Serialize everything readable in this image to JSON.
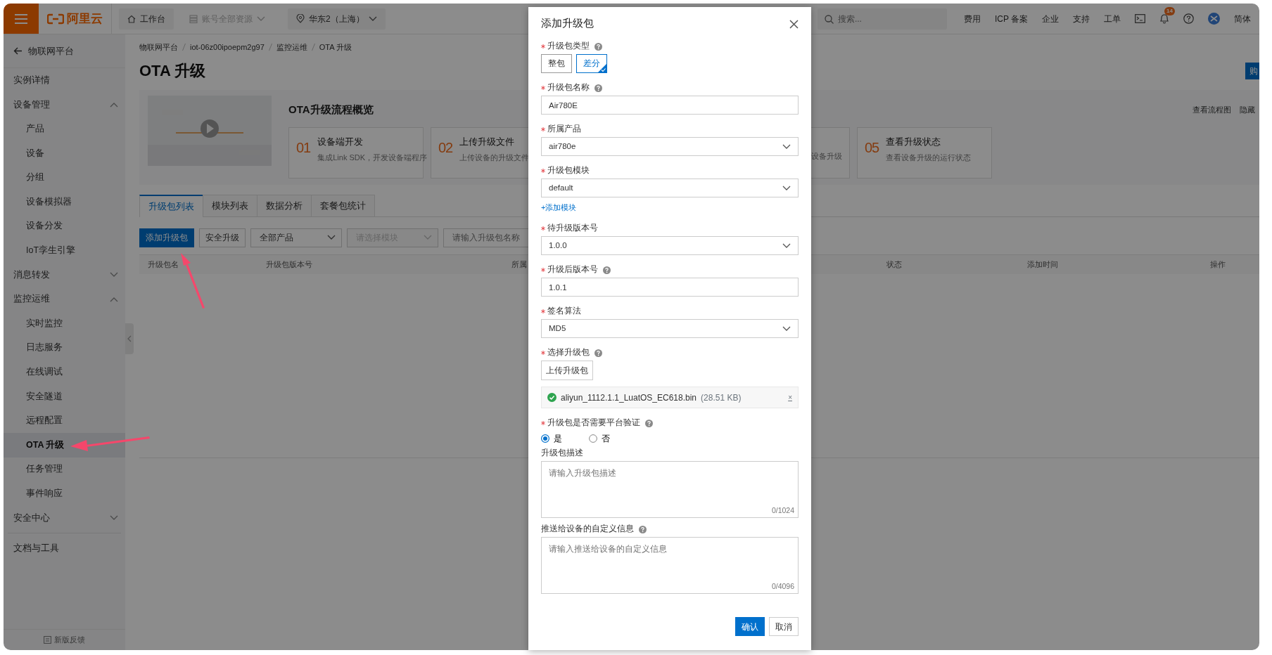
{
  "topbar": {
    "logo": "阿里云",
    "workbench": "工作台",
    "resource_group": {
      "label": "账号全部资源",
      "disabled": true
    },
    "region": "华东2（上海）",
    "search": {
      "placeholder": "搜索..."
    },
    "links": [
      "费用",
      "ICP 备案",
      "企业",
      "支持",
      "工单"
    ],
    "notification_count": "14",
    "language": "简体"
  },
  "sidebar": {
    "back_label": "物联网平台",
    "items": [
      {
        "label": "实例详情",
        "selected": false
      },
      {
        "label": "设备管理",
        "expanded": true,
        "selected": false,
        "children": [
          {
            "label": "产品",
            "selected": false
          },
          {
            "label": "设备",
            "selected": false
          },
          {
            "label": "分组",
            "selected": false
          },
          {
            "label": "设备模拟器",
            "selected": false
          },
          {
            "label": "设备分发",
            "selected": false
          },
          {
            "label": "IoT孪生引擎",
            "selected": false
          }
        ]
      },
      {
        "label": "消息转发",
        "expanded": false,
        "selected": false
      },
      {
        "label": "监控运维",
        "expanded": true,
        "selected": false,
        "children": [
          {
            "label": "实时监控",
            "selected": false
          },
          {
            "label": "日志服务",
            "selected": false
          },
          {
            "label": "在线调试",
            "selected": false
          },
          {
            "label": "安全隧道",
            "selected": false
          },
          {
            "label": "远程配置",
            "selected": false
          },
          {
            "label": "OTA 升级",
            "selected": true
          },
          {
            "label": "任务管理",
            "selected": false
          },
          {
            "label": "事件响应",
            "selected": false
          }
        ]
      },
      {
        "label": "安全中心",
        "expanded": false,
        "selected": false
      },
      {
        "label": "文档与工具",
        "selected": false
      }
    ],
    "feedback": "新版反馈"
  },
  "breadcrumb": [
    "物联网平台",
    "iot-06z00ipoepm2g97",
    "监控运维",
    "OTA 升级"
  ],
  "page_title": "OTA 升级",
  "buy_button": "购",
  "overview": {
    "title": "OTA升级流程概览",
    "links": [
      "查看流程图",
      "隐藏"
    ],
    "steps": [
      {
        "number": "01",
        "title": "设备端开发",
        "desc": "集成Link SDK，开发设备端程序"
      },
      {
        "number": "02",
        "title": "上传升级文件",
        "desc": "上传设备的升级文件"
      },
      {
        "desc": "设备升级"
      },
      {
        "number": "05",
        "title": "查看升级状态",
        "desc": "查看设备升级的运行状态"
      }
    ]
  },
  "tabs": [
    {
      "label": "升级包列表",
      "selected": true
    },
    {
      "label": "模块列表",
      "selected": false
    },
    {
      "label": "数据分析",
      "selected": false
    },
    {
      "label": "套餐包统计",
      "selected": false
    }
  ],
  "toolbar": {
    "add_button": "添加升级包",
    "secure_button": "安全升级",
    "product_filter": "全部产品",
    "module_filter": {
      "placeholder": "请选择模块",
      "disabled": true
    },
    "name_search": {
      "placeholder": "请输入升级包名称"
    }
  },
  "table": {
    "columns": [
      "升级包名",
      "升级包版本号",
      "所属",
      "状态",
      "添加时间",
      "操作"
    ]
  },
  "modal": {
    "title": "添加升级包",
    "fields": [
      {
        "kind": "segmented",
        "label": "升级包类型",
        "required": true,
        "help": true,
        "options": [
          {
            "label": "整包",
            "selected": false
          },
          {
            "label": "差分",
            "selected": true
          }
        ]
      },
      {
        "kind": "input",
        "label": "升级包名称",
        "required": true,
        "help": true,
        "value": "Air780E"
      },
      {
        "kind": "select",
        "label": "所属产品",
        "required": true,
        "help": false,
        "value": "air780e"
      },
      {
        "kind": "select",
        "label": "升级包模块",
        "required": true,
        "help": false,
        "value": "default",
        "link": "+添加模块"
      },
      {
        "kind": "select",
        "label": "待升级版本号",
        "required": true,
        "help": false,
        "value": "1.0.0"
      },
      {
        "kind": "input",
        "label": "升级后版本号",
        "required": true,
        "help": true,
        "value": "1.0.1"
      },
      {
        "kind": "select",
        "label": "签名算法",
        "required": true,
        "help": false,
        "value": "MD5"
      },
      {
        "kind": "upload",
        "label": "选择升级包",
        "required": true,
        "help": true,
        "button": "上传升级包",
        "file": {
          "name": "aliyun_1112.1.1_LuatOS_EC618.bin",
          "size": "(28.51 KB)",
          "remove": "×"
        }
      },
      {
        "kind": "radio",
        "label": "升级包是否需要平台验证",
        "required": true,
        "help": true,
        "options": [
          {
            "label": "是",
            "selected": true
          },
          {
            "label": "否",
            "selected": false
          }
        ]
      },
      {
        "kind": "textarea",
        "label": "升级包描述",
        "required": false,
        "help": false,
        "placeholder": "请输入升级包描述",
        "counter": "0/1024"
      },
      {
        "kind": "textarea",
        "label": "推送给设备的自定义信息",
        "required": false,
        "help": true,
        "placeholder": "请输入推送给设备的自定义信息",
        "counter": "0/4096"
      }
    ],
    "buttons": [
      {
        "label": "确认",
        "primary": true
      },
      {
        "label": "取消",
        "primary": false
      }
    ]
  }
}
